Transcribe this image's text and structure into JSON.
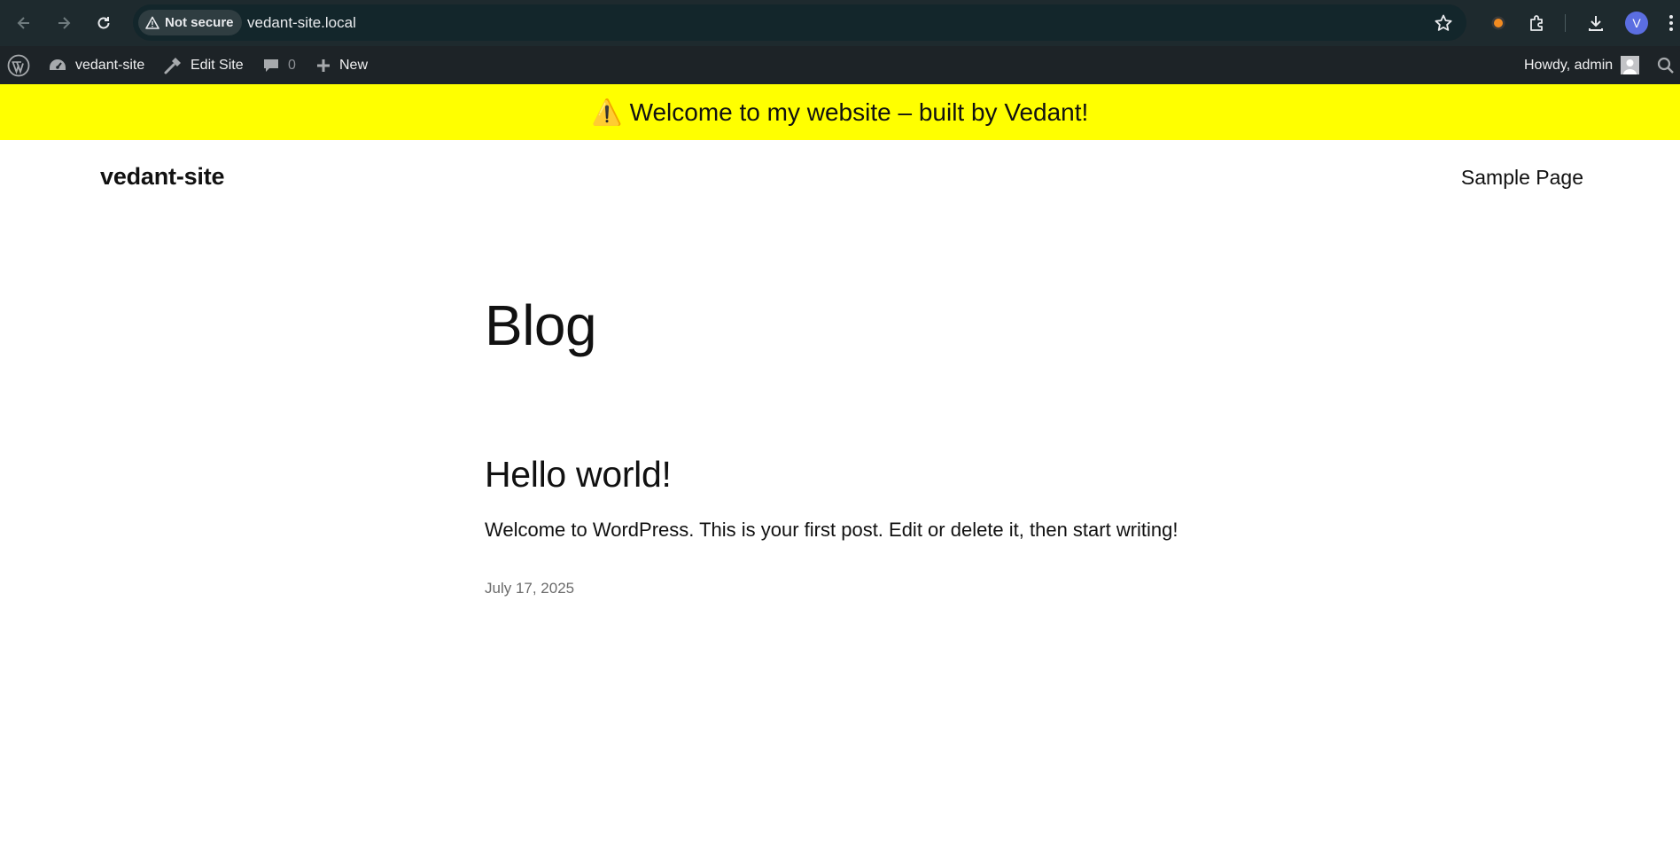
{
  "browser": {
    "security_label": "Not secure",
    "url": "vedant-site.local",
    "profile_initial": "V"
  },
  "admin_bar": {
    "site_name": "vedant-site",
    "edit_site": "Edit Site",
    "comments_count": "0",
    "new_label": "New",
    "howdy": "Howdy, admin"
  },
  "announcement": {
    "icon": "⚠️",
    "text": "Welcome to my website – built by Vedant!"
  },
  "site": {
    "title": "vedant-site",
    "nav": [
      "Sample Page"
    ]
  },
  "main": {
    "page_title": "Blog",
    "posts": [
      {
        "title": "Hello world!",
        "excerpt": "Welcome to WordPress. This is your first post. Edit or delete it, then start writing!",
        "date": "July 17, 2025"
      }
    ]
  },
  "colors": {
    "announcement_bg": "#ffff00",
    "admin_bar_bg": "#1d2327",
    "browser_bar_bg": "#1e2a2e"
  }
}
